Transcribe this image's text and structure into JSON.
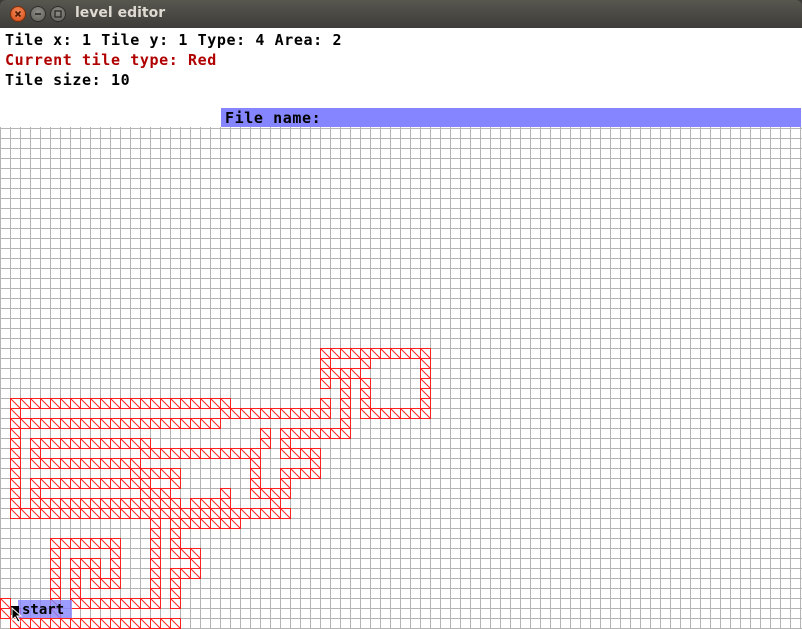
{
  "window": {
    "title": "level editor"
  },
  "info": {
    "tile_line": "Tile x: 1 Tile y: 1 Type: 4 Area: 2",
    "tile_type_line": "Current tile type: Red",
    "tile_size_line": "Tile size: 10"
  },
  "file_name": {
    "label": "File name:"
  },
  "start_label": "start",
  "colors": {
    "grid_line": "#b4b4b4",
    "red_tile": "#ff2020",
    "highlight": "#8585ff",
    "info_red": "#b00000"
  },
  "grid": {
    "tile_size": 10,
    "red_rows": [
      {
        "row": 22,
        "cols": [
          [
            32,
            42
          ]
        ]
      },
      {
        "row": 23,
        "cols": [
          [
            32,
            32
          ],
          [
            36,
            36
          ],
          [
            42,
            42
          ]
        ]
      },
      {
        "row": 24,
        "cols": [
          [
            32,
            35
          ],
          [
            42,
            42
          ]
        ]
      },
      {
        "row": 25,
        "cols": [
          [
            32,
            32
          ],
          [
            34,
            34
          ],
          [
            36,
            36
          ],
          [
            42,
            42
          ]
        ]
      },
      {
        "row": 26,
        "cols": [
          [
            34,
            34
          ],
          [
            36,
            36
          ],
          [
            42,
            42
          ]
        ]
      },
      {
        "row": 27,
        "cols": [
          [
            1,
            22
          ],
          [
            32,
            32
          ],
          [
            34,
            34
          ],
          [
            36,
            36
          ],
          [
            42,
            42
          ]
        ]
      },
      {
        "row": 28,
        "cols": [
          [
            1,
            1
          ],
          [
            22,
            32
          ],
          [
            34,
            34
          ],
          [
            36,
            42
          ]
        ]
      },
      {
        "row": 29,
        "cols": [
          [
            1,
            21
          ],
          [
            34,
            34
          ]
        ]
      },
      {
        "row": 30,
        "cols": [
          [
            1,
            1
          ],
          [
            26,
            26
          ],
          [
            28,
            34
          ]
        ]
      },
      {
        "row": 31,
        "cols": [
          [
            1,
            1
          ],
          [
            3,
            14
          ],
          [
            26,
            26
          ],
          [
            28,
            28
          ]
        ]
      },
      {
        "row": 32,
        "cols": [
          [
            1,
            1
          ],
          [
            3,
            3
          ],
          [
            14,
            25
          ],
          [
            28,
            31
          ]
        ]
      },
      {
        "row": 33,
        "cols": [
          [
            1,
            1
          ],
          [
            3,
            13
          ],
          [
            25,
            25
          ],
          [
            31,
            31
          ]
        ]
      },
      {
        "row": 34,
        "cols": [
          [
            1,
            1
          ],
          [
            13,
            17
          ],
          [
            25,
            25
          ],
          [
            28,
            31
          ]
        ]
      },
      {
        "row": 35,
        "cols": [
          [
            1,
            1
          ],
          [
            3,
            14
          ],
          [
            17,
            17
          ],
          [
            25,
            25
          ],
          [
            28,
            28
          ]
        ]
      },
      {
        "row": 36,
        "cols": [
          [
            1,
            1
          ],
          [
            3,
            3
          ],
          [
            14,
            16
          ],
          [
            22,
            22
          ],
          [
            25,
            28
          ]
        ]
      },
      {
        "row": 37,
        "cols": [
          [
            1,
            1
          ],
          [
            3,
            16
          ],
          [
            17,
            17
          ],
          [
            19,
            22
          ],
          [
            27,
            27
          ]
        ]
      },
      {
        "row": 38,
        "cols": [
          [
            1,
            28
          ]
        ]
      },
      {
        "row": 39,
        "cols": [
          [
            15,
            15
          ],
          [
            17,
            23
          ]
        ]
      },
      {
        "row": 40,
        "cols": [
          [
            15,
            15
          ],
          [
            17,
            17
          ]
        ]
      },
      {
        "row": 41,
        "cols": [
          [
            5,
            11
          ],
          [
            15,
            15
          ],
          [
            17,
            17
          ]
        ]
      },
      {
        "row": 42,
        "cols": [
          [
            5,
            5
          ],
          [
            11,
            11
          ],
          [
            15,
            15
          ],
          [
            17,
            19
          ]
        ]
      },
      {
        "row": 43,
        "cols": [
          [
            5,
            5
          ],
          [
            7,
            9
          ],
          [
            11,
            11
          ],
          [
            15,
            15
          ],
          [
            19,
            19
          ]
        ]
      },
      {
        "row": 44,
        "cols": [
          [
            5,
            5
          ],
          [
            7,
            7
          ],
          [
            9,
            9
          ],
          [
            11,
            11
          ],
          [
            15,
            15
          ],
          [
            17,
            19
          ]
        ]
      },
      {
        "row": 45,
        "cols": [
          [
            5,
            5
          ],
          [
            7,
            7
          ],
          [
            9,
            11
          ],
          [
            15,
            15
          ],
          [
            17,
            17
          ]
        ]
      },
      {
        "row": 46,
        "cols": [
          [
            5,
            5
          ],
          [
            7,
            7
          ],
          [
            15,
            15
          ],
          [
            17,
            17
          ]
        ]
      },
      {
        "row": 47,
        "cols": [
          [
            0,
            0
          ],
          [
            5,
            5
          ],
          [
            7,
            15
          ],
          [
            17,
            17
          ]
        ]
      },
      {
        "row": 48,
        "cols": [
          [
            0,
            1
          ],
          [
            5,
            5
          ]
        ]
      },
      {
        "row": 49,
        "cols": [
          [
            1,
            17
          ]
        ]
      }
    ],
    "start_cell": {
      "col": 1,
      "row": 48
    },
    "cursor_cell": {
      "col": 1,
      "row": 49
    }
  }
}
